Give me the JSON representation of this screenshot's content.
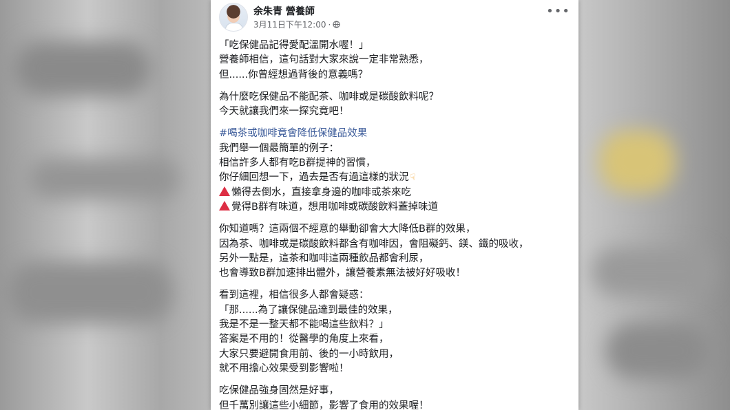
{
  "post": {
    "author": "余朱青 營養師",
    "timestamp": "3月11日下午12:00",
    "separator": "·",
    "paragraphs": [
      [
        "「吃保健品記得愛配溫開水喔！」",
        "營養師相信，這句話對大家來說一定非常熟悉，",
        "但......你曾經想過背後的意義嗎？"
      ],
      [
        "為什麼吃保健品不能配茶、咖啡或是碳酸飲料呢？",
        "今天就讓我們來一探究竟吧！"
      ]
    ],
    "hashtag": "#喝茶或咖啡竟會降低保健品效果",
    "example_lines": [
      "我們舉一個最簡單的例子：",
      "相信許多人都有吃B群提神的習慣，",
      "你仔細回想一下，過去是否有過這樣的狀況"
    ],
    "warn_lines": [
      "懶得去倒水，直接拿身邊的咖啡或茶來吃",
      "覺得B群有味道，想用咖啡或碳酸飲料蓋掉味道"
    ],
    "paragraphs_after": [
      [
        "你知道嗎？這兩個不經意的舉動卻會大大降低B群的效果，",
        "因為茶、咖啡或是碳酸飲料都含有咖啡因，會阻礙鈣、鎂、鐵的吸收，",
        "另外一點是，這茶和咖啡這兩種飲品都會利尿，",
        "也會導致B群加速排出體外，讓營養素無法被好好吸收！"
      ],
      [
        "看到這裡，相信很多人都會疑惑：",
        "「那......為了讓保健品達到最佳的效果，",
        "我是不是一整天都不能喝這些飲料？」",
        "答案是不用的！從醫學的角度上來看，",
        "大家只要避開食用前、後的一小時飲用，",
        "就不用擔心效果受到影響啦！"
      ],
      [
        "吃保健品強身固然是好事，",
        "但千萬別讓這些小細節，影響了食用的效果喔！"
      ]
    ]
  },
  "icons": {
    "more": "more-options-icon",
    "globe": "globe-icon",
    "warning": "red-triangle-icon",
    "pointing": "backhand-index-pointing-down-icon"
  },
  "colors": {
    "hashtag": "#385898",
    "warning": "#dd2e44",
    "meta": "#65676b"
  }
}
